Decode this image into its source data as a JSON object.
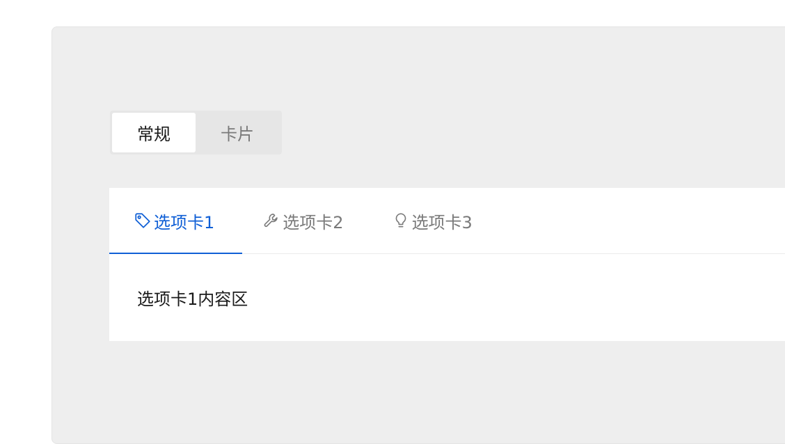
{
  "segmented": {
    "items": [
      {
        "label": "常规",
        "active": true
      },
      {
        "label": "卡片",
        "active": false
      }
    ]
  },
  "tabs": {
    "items": [
      {
        "label": "选项卡1",
        "icon": "tag-icon",
        "active": true
      },
      {
        "label": "选项卡2",
        "icon": "wrench-icon",
        "active": false
      },
      {
        "label": "选项卡3",
        "icon": "lightbulb-icon",
        "active": false
      }
    ],
    "content": "选项卡1内容区"
  },
  "colors": {
    "accent": "#0f5fd6",
    "inactive_text": "#7a7a7a",
    "panel_bg": "#eeeeee"
  }
}
